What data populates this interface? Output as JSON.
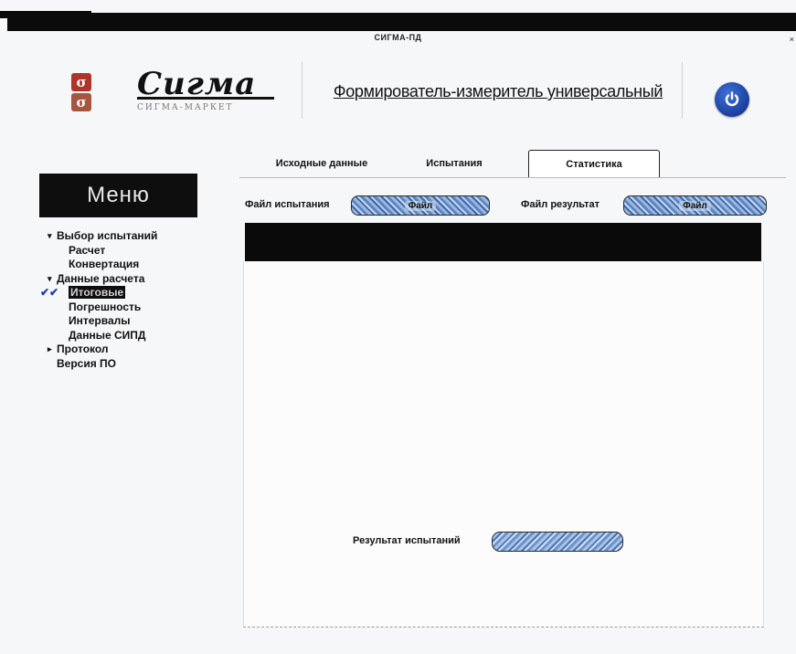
{
  "window": {
    "title": "СИГМА-ПД",
    "close_glyph": "×"
  },
  "header": {
    "logo_text": "Сигма",
    "logo_subtitle": "СИГМА-МАРКЕТ",
    "device_title": "Формирователь-измеритель универсальный",
    "power_icon": "power-icon"
  },
  "menu": {
    "title": "Меню",
    "items": [
      {
        "label": "Выбор испытаний",
        "level": 0,
        "expanded": true
      },
      {
        "label": "Расчет",
        "level": 1
      },
      {
        "label": "Конвертация",
        "level": 1
      },
      {
        "label": "Данные расчета",
        "level": 0,
        "expanded": true
      },
      {
        "label": "Итоговые",
        "level": 1,
        "selected": true,
        "checked": true
      },
      {
        "label": "Погрешность",
        "level": 1
      },
      {
        "label": "Интервалы",
        "level": 1
      },
      {
        "label": "Данные СИПД",
        "level": 1
      },
      {
        "label": "Протокол",
        "level": 0,
        "expanded": false
      },
      {
        "label": "Версия ПО",
        "level": 0
      }
    ]
  },
  "tabs": [
    {
      "label": "Исходные данные",
      "active": false
    },
    {
      "label": "Испытания",
      "active": false
    },
    {
      "label": "Статистика",
      "active": true
    }
  ],
  "files": {
    "test_file_label": "Файл испытания",
    "test_file_button": "Файл",
    "result_file_label": "Файл результат",
    "result_file_button": "Файл"
  },
  "result": {
    "label": "Результат испытаний",
    "value": ""
  },
  "colors": {
    "accent": "#1a3f9b",
    "logo_red": "#b13428",
    "menu_bg": "#0e0e0e"
  }
}
